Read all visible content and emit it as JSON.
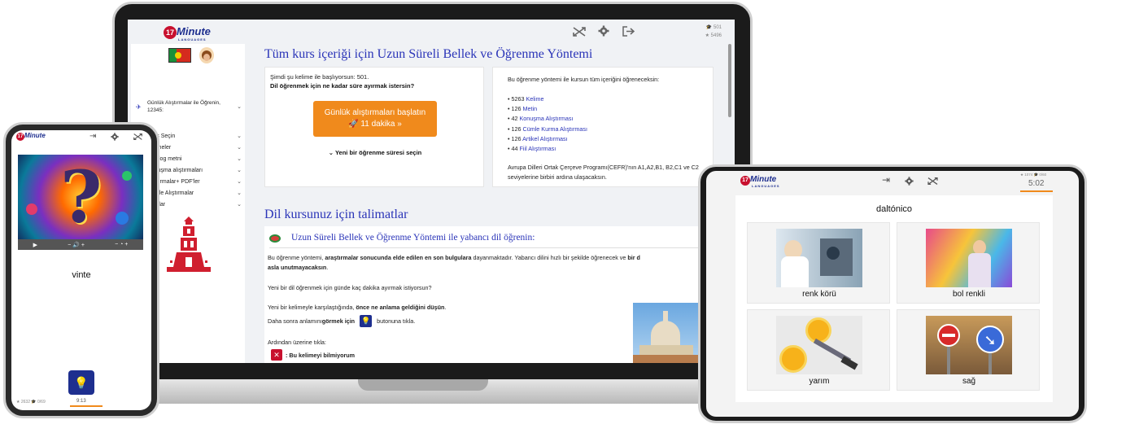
{
  "laptop": {
    "stats": {
      "graduation": "501",
      "stars": "5496"
    },
    "sidebar": {
      "daily_label": "Günlük Alıştırmalar ile Öğrenin,\n12345:",
      "items": [
        "Ders Seçin",
        "Kelimeler",
        "Diyalog metni",
        "Konuşma alıştırmaları",
        "Alıştırmalar+ PDF'ler",
        "Cümle Alıştırmalar",
        "Ayarlar"
      ]
    },
    "main": {
      "title": "Tüm kurs içeriği için Uzun Süreli Bellek ve Öğrenme Yöntemi",
      "start_line": "Şimdi şu kelime ile başlıyorsun: 501.",
      "question": "Dil öğrenmek için ne kadar süre ayırmak istersin?",
      "cta_line1": "Günlük alıştırmaları başlatın",
      "cta_line2": "11 dakika  »",
      "new_time": "Yeni bir öğrenme süresi seçin",
      "info_intro": "Bu öğrenme yöntemi ile kursun tüm içeriğini öğreneceksin:",
      "content_items": [
        {
          "count": "5263",
          "label": "Kelime"
        },
        {
          "count": "126",
          "label": "Metin"
        },
        {
          "count": "42",
          "label": "Konuşma Alıştırması"
        },
        {
          "count": "126",
          "label": "Cümle Kurma Alıştırması"
        },
        {
          "count": "126",
          "label": "Artikel Alıştırması"
        },
        {
          "count": "44",
          "label": "Fiil Alıştırması"
        }
      ],
      "cefr": "Avrupa Dilleri Ortak Çerçeve Programı(CEFR)'nın A1,A2,B1, B2,C1 ve C2 seviyelerine birbiri ardına ulaşacaksın.",
      "instructions_title": "Dil kursunuz için talimatlar",
      "method_title": "Uzun Süreli Bellek ve Öğrenme Yöntemi ile yabancı dil öğrenin:",
      "p1_a": "Bu öğrenme yöntemi, ",
      "p1_b": "araştırmalar sonucunda elde edilen en son bulgulara",
      "p1_c": " dayanmaktadır. Yabancı dilini hızlı bir şekilde öğrenecek ve ",
      "p1_d": "bir d",
      "p1_e": "asla unutmayacaksın",
      "p1_f": ".",
      "p2": "Yeni bir dil öğrenmek için günde kaç dakika ayırmak istiyorsun?",
      "p3_a": "Yeni bir kelimeyle karşılaştığında, ",
      "p3_b": "önce ne anlama geldiğini düşün",
      "p3_c": ".",
      "p4_a": "Daha sonra anlamını ",
      "p4_b": "görmek için",
      "p4_c": " butonuna tıkla.",
      "p5": "Ardından üzerine tıkla:",
      "p6": ": Bu kelimeyi bilmiyorum"
    }
  },
  "phone": {
    "word": "vinte",
    "stats": {
      "stars": "2632",
      "graduation": "0/69"
    },
    "time": "9:13"
  },
  "tablet": {
    "stats": {
      "stars": "1074",
      "graduation": "0/60"
    },
    "timer": "5:02",
    "word": "daltónico",
    "options": [
      "renk körü",
      "bol renkli",
      "yarım",
      "sağ"
    ]
  },
  "colors": {
    "brand_blue": "#1e2f8f",
    "accent_orange": "#f08a1c",
    "red": "#c8102e",
    "link_blue": "#2a34b8"
  }
}
